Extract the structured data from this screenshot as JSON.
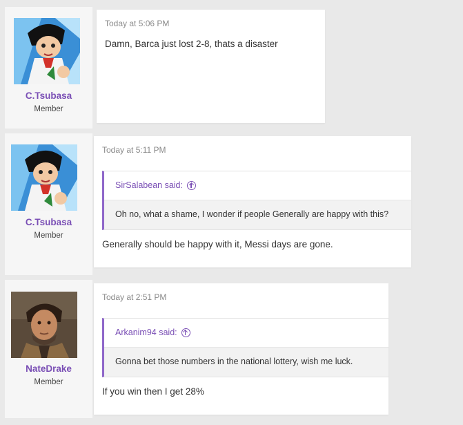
{
  "posts": [
    {
      "username": "C.Tsubasa",
      "role": "Member",
      "avatar": "anime-soccer-player-avatar",
      "timestamp": "Today at 5:06 PM",
      "message": "Damn, Barca just lost 2-8, thats a disaster"
    },
    {
      "username": "C.Tsubasa",
      "role": "Member",
      "avatar": "anime-soccer-player-avatar",
      "timestamp": "Today at 5:11 PM",
      "quote": {
        "author_line": "SirSalabean said:",
        "text": "Oh no, what a shame, I wonder if people Generally are happy with this?"
      },
      "message": "Generally should be happy with it, Messi days are gone."
    },
    {
      "username": "NateDrake",
      "role": "Member",
      "avatar": "adventurer-man-avatar",
      "timestamp": "Today at 2:51 PM",
      "quote": {
        "author_line": "Arkanim94 said:",
        "text": "Gonna bet those numbers in the national lottery, wish me luck."
      },
      "message": "If you win then I get 28%"
    }
  ],
  "colors": {
    "username": "#7a4fb5",
    "quote_border": "#8e66c9",
    "background": "#e9e9e9"
  }
}
